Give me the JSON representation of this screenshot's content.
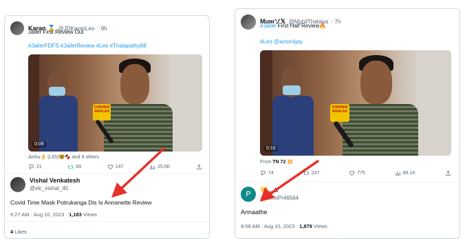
{
  "left_tweet": {
    "author_name": "Karan 🥇",
    "author_handle": "@JDKaranLeo",
    "time": "· 9h",
    "text": "Jailer First Review Out",
    "hashtags": "#JailerFDFS #JailerReview #Leo #Thalapathy68",
    "video_time": "0:09",
    "mic_tag": "CHENNAI WAALAA",
    "liked_by": "Aishu👌 (L65)🤓🍫 and 9 others",
    "replies": "21",
    "retweets": "69",
    "likes": "147",
    "views": "25.5K"
  },
  "left_reply": {
    "author_name": "Vishal Venkatesh",
    "author_handle": "@vlc_vishal_45",
    "text": "Covid Time Mask Potrukanga Dis Is Annanette Review",
    "timestamp": "6:27 AM · Aug 10, 2023 · ",
    "views_count": "1,183",
    "views_label": " Views",
    "likes_count": "4",
    "likes_label": " Likes"
  },
  "right_tweet": {
    "author_name": "Muнιソ𝕏",
    "author_handle": "@MuhilThalaiva",
    "time": "· 7h",
    "hashtag_text": "#Jailer",
    "text_rest": " First Half Review🔥",
    "hashtags": "#Leo @actorvijay",
    "video_time": "0:10",
    "mic_tag": "CHENNAI WAALAA",
    "from_label": "From ",
    "from_source": "TN 72 💥",
    "replies": "74",
    "retweets": "247",
    "likes": "775",
    "views": "88.1K"
  },
  "right_reply": {
    "avatar_letter": "P",
    "author_name": "💛 ...k",
    "author_handle": "@P...mPr46564",
    "text": "Annaathe",
    "timestamp": "8:08 AM · Aug 10, 2023 · ",
    "views_count": "1,879",
    "views_label": " Views"
  },
  "colors": {
    "accent": "#1d9bf0",
    "annotation_arrow": "#e8302a",
    "retweet_green": "#00ba7c"
  }
}
